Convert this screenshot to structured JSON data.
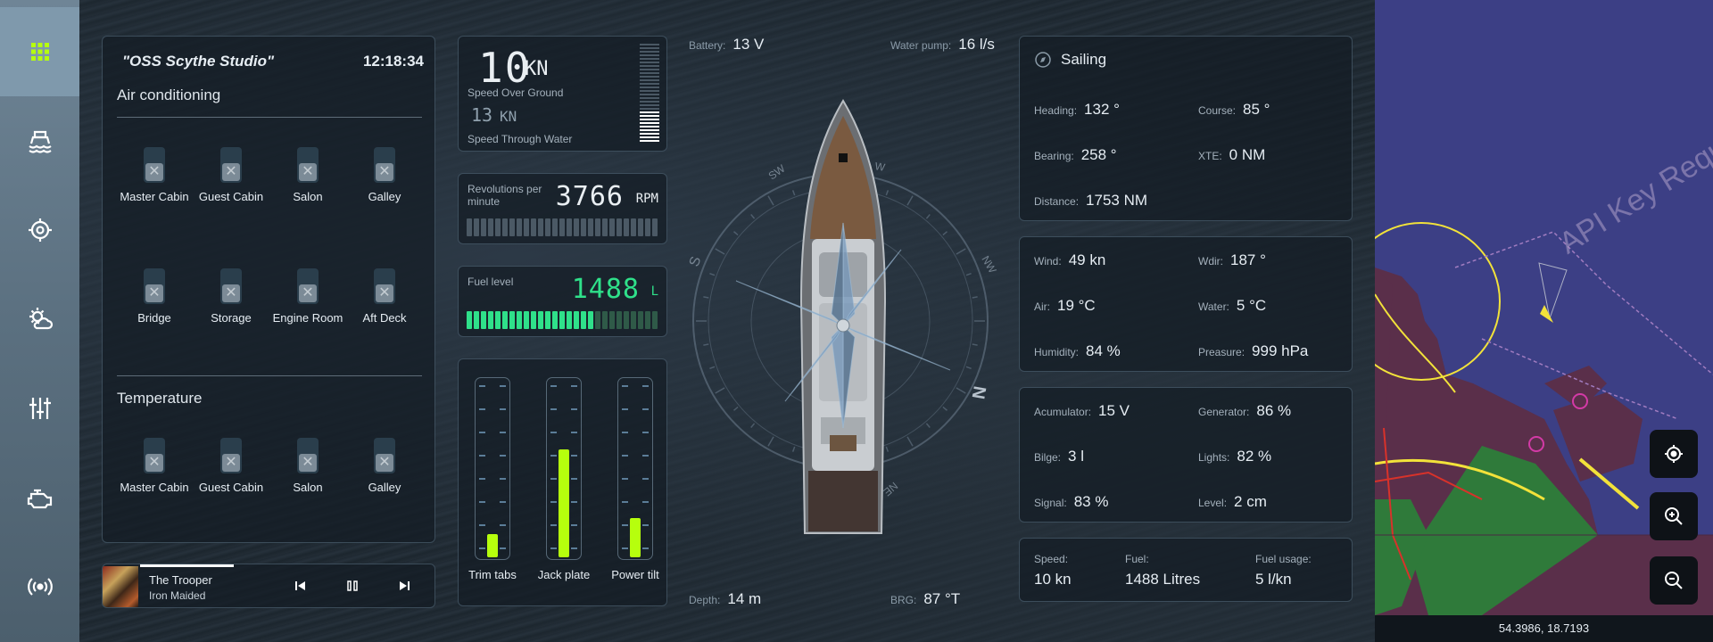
{
  "sidebar": {
    "items": [
      {
        "icon": "grid-icon",
        "active": true
      },
      {
        "icon": "ship-icon"
      },
      {
        "icon": "crosshair-icon"
      },
      {
        "icon": "weather-icon"
      },
      {
        "icon": "sliders-icon"
      },
      {
        "icon": "engine-icon"
      },
      {
        "icon": "radio-signal-icon"
      }
    ],
    "accent_color": "#b6ff0d"
  },
  "ac_panel": {
    "title": "\"OSS Scythe Studio\"",
    "clock": "12:18:34",
    "air_title": "Air conditioning",
    "air_zones": [
      "Master Cabin",
      "Guest Cabin",
      "Salon",
      "Galley",
      "Bridge",
      "Storage",
      "Engine Room",
      "Aft Deck"
    ],
    "temp_title": "Temperature",
    "temp_zones": [
      "Master Cabin",
      "Guest Cabin",
      "Salon",
      "Galley"
    ]
  },
  "music": {
    "song": "The Trooper",
    "artist": "Iron Maided",
    "progress": 0.35
  },
  "speed": {
    "sog_value": "10",
    "sog_unit": "KN",
    "sog_label": "Speed Over Ground",
    "stw_value": "13",
    "stw_unit": "KN",
    "stw_label": "Speed Through Water"
  },
  "rpm": {
    "label": "Revolutions per minute",
    "value": "3766",
    "unit": "RPM",
    "fill": 0.0
  },
  "fuel": {
    "label": "Fuel level",
    "value": "1488",
    "unit": "L",
    "fill": 0.65
  },
  "tilt": {
    "columns": [
      {
        "label": "Trim tabs",
        "level": 0.13
      },
      {
        "label": "Jack plate",
        "level": 0.61
      },
      {
        "label": "Power tilt",
        "level": 0.22
      }
    ]
  },
  "center": {
    "battery_label": "Battery:",
    "battery_value": "13 V",
    "pump_label": "Water pump:",
    "pump_value": "16 l/s",
    "depth_label": "Depth:",
    "depth_value": "14 m",
    "brg_label": "BRG:",
    "brg_value": "87 °T"
  },
  "nav_panel": {
    "title": "Sailing",
    "heading_label": "Heading:",
    "heading_value": "132 °",
    "course_label": "Course:",
    "course_value": "85 °",
    "bearing_label": "Bearing:",
    "bearing_value": "258 °",
    "xte_label": "XTE:",
    "xte_value": "0 NM",
    "distance_label": "Distance:",
    "distance_value": "1753 NM"
  },
  "env_panel": {
    "wind_label": "Wind:",
    "wind_value": "49 kn",
    "wdir_label": "Wdir:",
    "wdir_value": "187 °",
    "air_label": "Air:",
    "air_value": "19 °C",
    "water_label": "Water:",
    "water_value": "5 °C",
    "humidity_label": "Humidity:",
    "humidity_value": "84 %",
    "pressure_label": "Preasure:",
    "pressure_value": "999 hPa"
  },
  "power_panel": {
    "acc_label": "Acumulator:",
    "acc_value": "15 V",
    "gen_label": "Generator:",
    "gen_value": "86 %",
    "bilge_label": "Bilge:",
    "bilge_value": "3 l",
    "lights_label": "Lights:",
    "lights_value": "82 %",
    "signal_label": "Signal:",
    "signal_value": "83 %",
    "level_label": "Level:",
    "level_value": "2 cm"
  },
  "summary_panel": {
    "speed_label": "Speed:",
    "speed_value": "10 kn",
    "fuel_label": "Fuel:",
    "fuel_value": "1488 Litres",
    "usage_label": "Fuel usage:",
    "usage_value": "5 l/kn"
  },
  "map": {
    "watermark": "API Key Requ",
    "coords": "54.3986, 18.7193",
    "water_color": "#3c3f85",
    "land_color": "#5a2f4a"
  },
  "compass": {
    "labels": [
      "S",
      "SW",
      "W",
      "NW",
      "N",
      "NE"
    ]
  }
}
